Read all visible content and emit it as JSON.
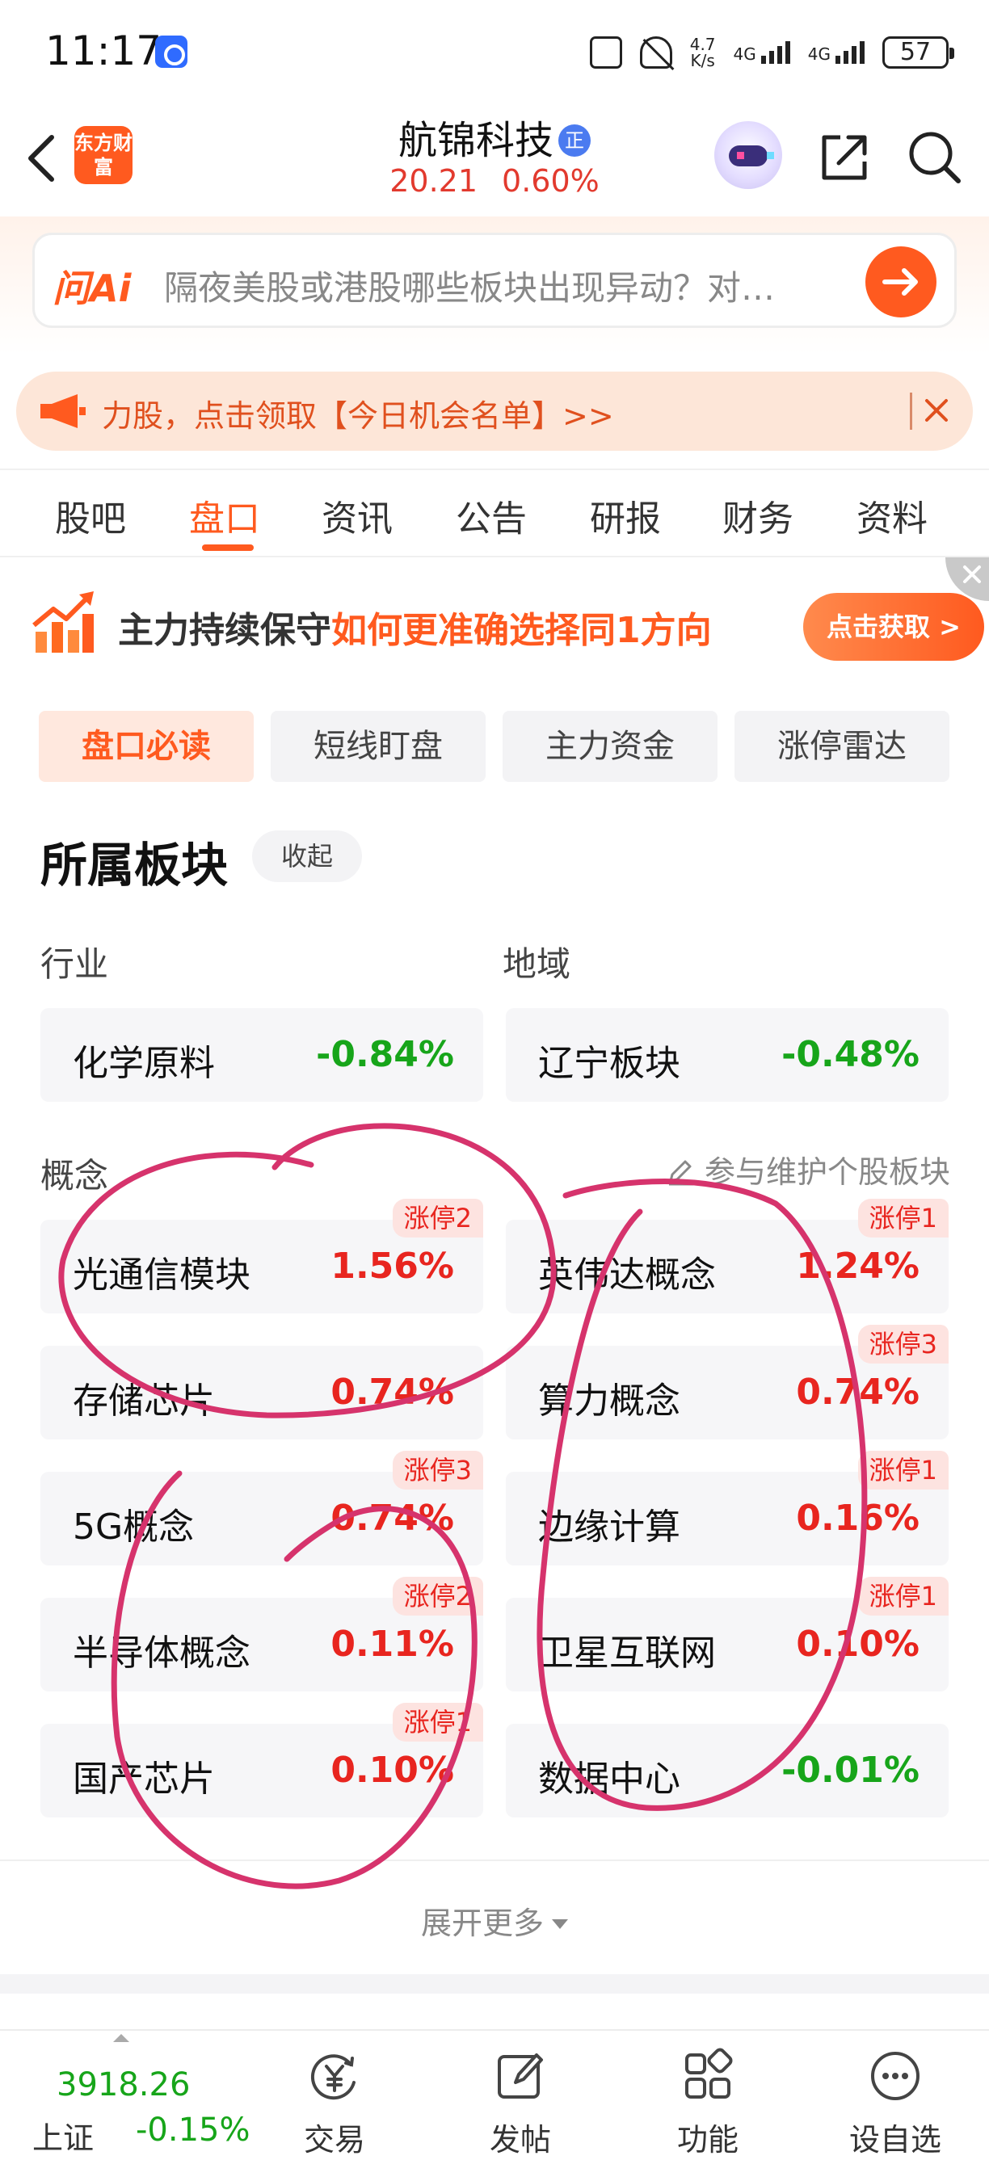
{
  "status_bar": {
    "time": "11:17",
    "speed_value": "4.7",
    "speed_unit": "K/s",
    "net1": "4G",
    "net2": "4G",
    "battery": "57"
  },
  "header": {
    "logo_text": "东方财富",
    "stock_name": "航锦科技",
    "stock_badge": "正",
    "price": "20.21",
    "change_pct": "0.60%"
  },
  "ai_bar": {
    "logo": "问Ai",
    "placeholder": "隔夜美股或港股哪些板块出现异动？对…"
  },
  "promo": {
    "text": "力股，点击领取【今日机会名单】>>"
  },
  "tabs": [
    "股吧",
    "盘口",
    "资讯",
    "公告",
    "研报",
    "财务",
    "资料"
  ],
  "active_tab": "盘口",
  "ad_banner": {
    "text_a": "主力持续保守",
    "text_b": "如何更准确选择同1方向",
    "button": "点击获取 >"
  },
  "subtabs": [
    "盘口必读",
    "短线盯盘",
    "主力资金",
    "涨停雷达"
  ],
  "section": {
    "title": "所属板块",
    "collapse": "收起",
    "industry_label": "行业",
    "region_label": "地域",
    "concept_label": "概念",
    "maintain": "参与维护个股板块",
    "expand_more": "展开更多"
  },
  "industry": [
    {
      "name": "化学原料",
      "pct": "-0.84%"
    }
  ],
  "region": [
    {
      "name": "辽宁板块",
      "pct": "-0.48%"
    }
  ],
  "concepts": [
    {
      "name": "光通信模块",
      "pct": "1.56%",
      "tag": "涨停2"
    },
    {
      "name": "英伟达概念",
      "pct": "1.24%",
      "tag": "涨停1"
    },
    {
      "name": "存储芯片",
      "pct": "0.74%",
      "tag": ""
    },
    {
      "name": "算力概念",
      "pct": "0.74%",
      "tag": "涨停3"
    },
    {
      "name": "5G概念",
      "pct": "0.74%",
      "tag": "涨停3"
    },
    {
      "name": "边缘计算",
      "pct": "0.16%",
      "tag": "涨停1"
    },
    {
      "name": "半导体概念",
      "pct": "0.11%",
      "tag": "涨停2"
    },
    {
      "name": "卫星互联网",
      "pct": "0.10%",
      "tag": "涨停1"
    },
    {
      "name": "国产芯片",
      "pct": "0.10%",
      "tag": "涨停1"
    },
    {
      "name": "数据中心",
      "pct": "-0.01%",
      "tag": ""
    }
  ],
  "bottom_nav": {
    "index_value": "3918.26",
    "index_name": "上证",
    "index_change": "-0.15%",
    "items": [
      "交易",
      "发帖",
      "功能",
      "设自选"
    ]
  },
  "colors": {
    "accent": "#ff5a1f",
    "up": "#e8251f",
    "down": "#17a51a",
    "annotation": "#d6336c"
  }
}
